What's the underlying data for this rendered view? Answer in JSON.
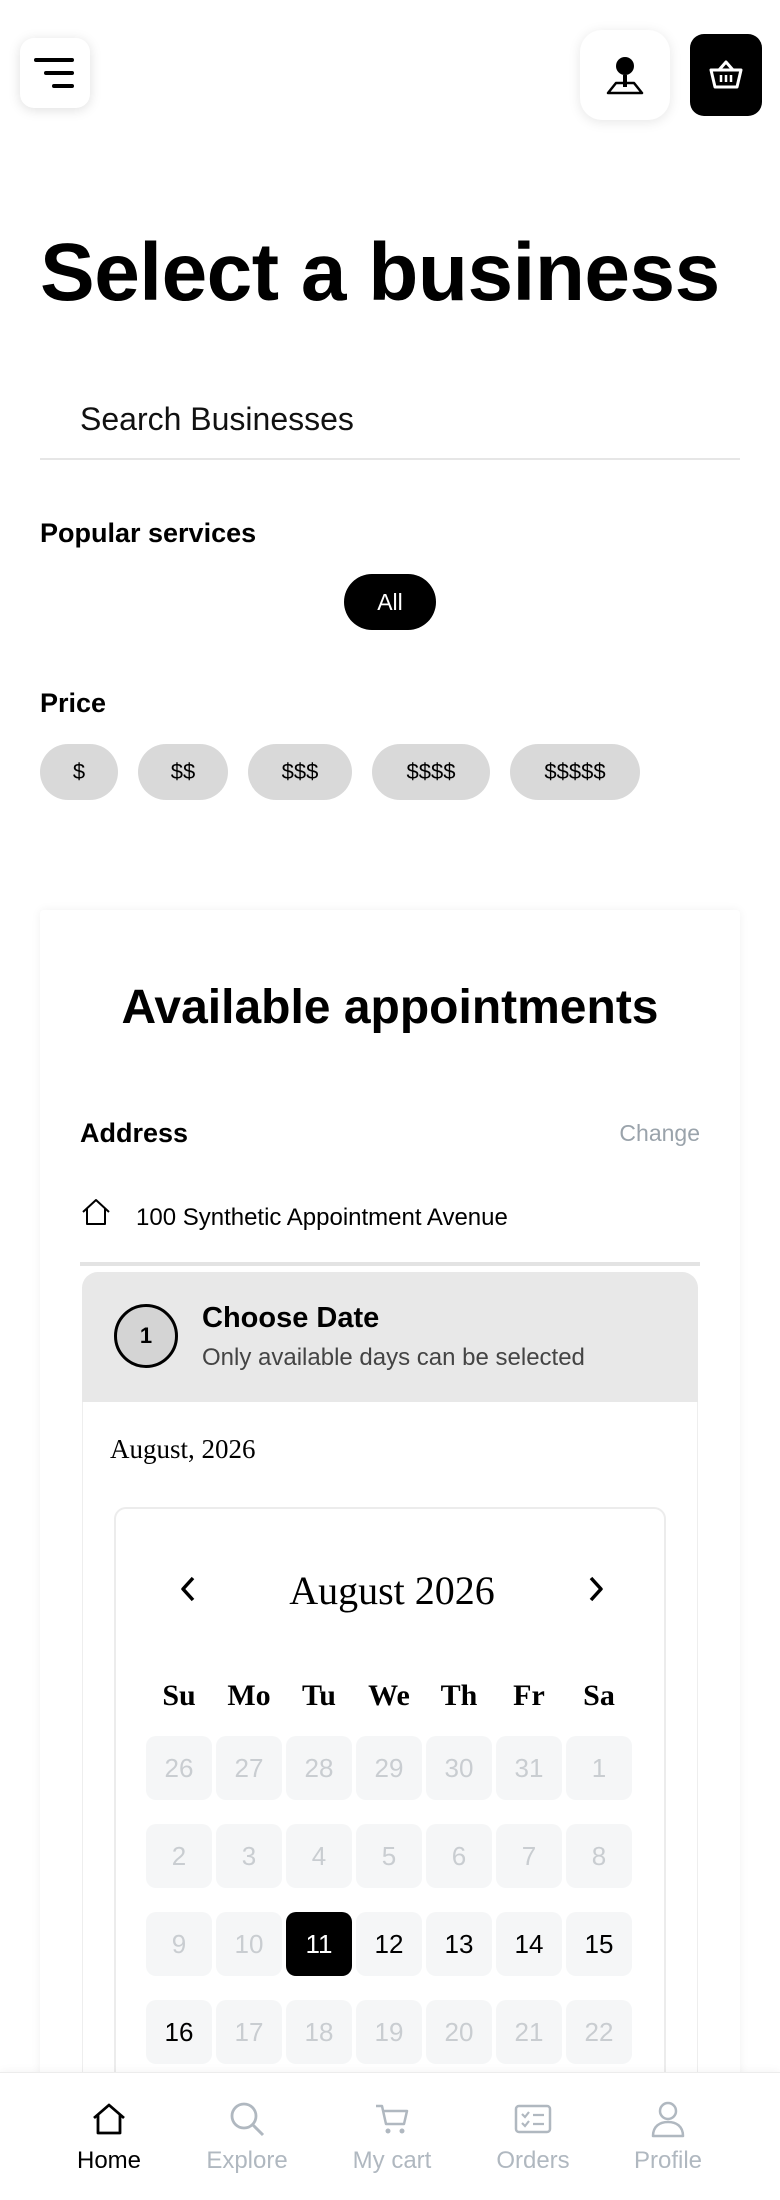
{
  "header": {
    "menu_icon": "menu-icon",
    "location_icon": "map-pin-icon",
    "cart_icon": "basket-icon"
  },
  "page": {
    "title": "Select a business",
    "search_placeholder": "Search Businesses"
  },
  "filters": {
    "popular_label": "Popular services",
    "popular_chips": [
      "All"
    ],
    "price_label": "Price",
    "price_chips": [
      "$",
      "$$",
      "$$$",
      "$$$$",
      "$$$$$"
    ]
  },
  "appointments": {
    "title": "Available appointments",
    "address_label": "Address",
    "change_label": "Change",
    "address": "100 Synthetic Appointment Avenue",
    "step_number": "1",
    "step_title": "Choose Date",
    "step_subtitle": "Only available days can be selected",
    "selected_month": "August, 2026",
    "calendar": {
      "title": "August 2026",
      "weekdays": [
        "Su",
        "Mo",
        "Tu",
        "We",
        "Th",
        "Fr",
        "Sa"
      ],
      "days": [
        {
          "d": "26",
          "s": "disabled"
        },
        {
          "d": "27",
          "s": "disabled"
        },
        {
          "d": "28",
          "s": "disabled"
        },
        {
          "d": "29",
          "s": "disabled"
        },
        {
          "d": "30",
          "s": "disabled"
        },
        {
          "d": "31",
          "s": "disabled"
        },
        {
          "d": "1",
          "s": "disabled"
        },
        {
          "d": "2",
          "s": "disabled"
        },
        {
          "d": "3",
          "s": "disabled"
        },
        {
          "d": "4",
          "s": "disabled"
        },
        {
          "d": "5",
          "s": "disabled"
        },
        {
          "d": "6",
          "s": "disabled"
        },
        {
          "d": "7",
          "s": "disabled"
        },
        {
          "d": "8",
          "s": "disabled"
        },
        {
          "d": "9",
          "s": "disabled"
        },
        {
          "d": "10",
          "s": "disabled"
        },
        {
          "d": "11",
          "s": "selected"
        },
        {
          "d": "12",
          "s": "available"
        },
        {
          "d": "13",
          "s": "available"
        },
        {
          "d": "14",
          "s": "available"
        },
        {
          "d": "15",
          "s": "available"
        },
        {
          "d": "16",
          "s": "available"
        },
        {
          "d": "17",
          "s": "disabled"
        },
        {
          "d": "18",
          "s": "disabled"
        },
        {
          "d": "19",
          "s": "disabled"
        },
        {
          "d": "20",
          "s": "disabled"
        },
        {
          "d": "21",
          "s": "disabled"
        },
        {
          "d": "22",
          "s": "disabled"
        }
      ]
    }
  },
  "bottom_nav": [
    {
      "label": "Home",
      "icon": "home-icon",
      "active": true
    },
    {
      "label": "Explore",
      "icon": "search-icon",
      "active": false
    },
    {
      "label": "My cart",
      "icon": "cart-icon",
      "active": false
    },
    {
      "label": "Orders",
      "icon": "orders-icon",
      "active": false
    },
    {
      "label": "Profile",
      "icon": "profile-icon",
      "active": false
    }
  ],
  "colors": {
    "accent": "#000000",
    "chip_inactive": "#d9d9d9",
    "muted_text": "#9aa3ab",
    "nav_inactive": "#b0b8c0"
  }
}
